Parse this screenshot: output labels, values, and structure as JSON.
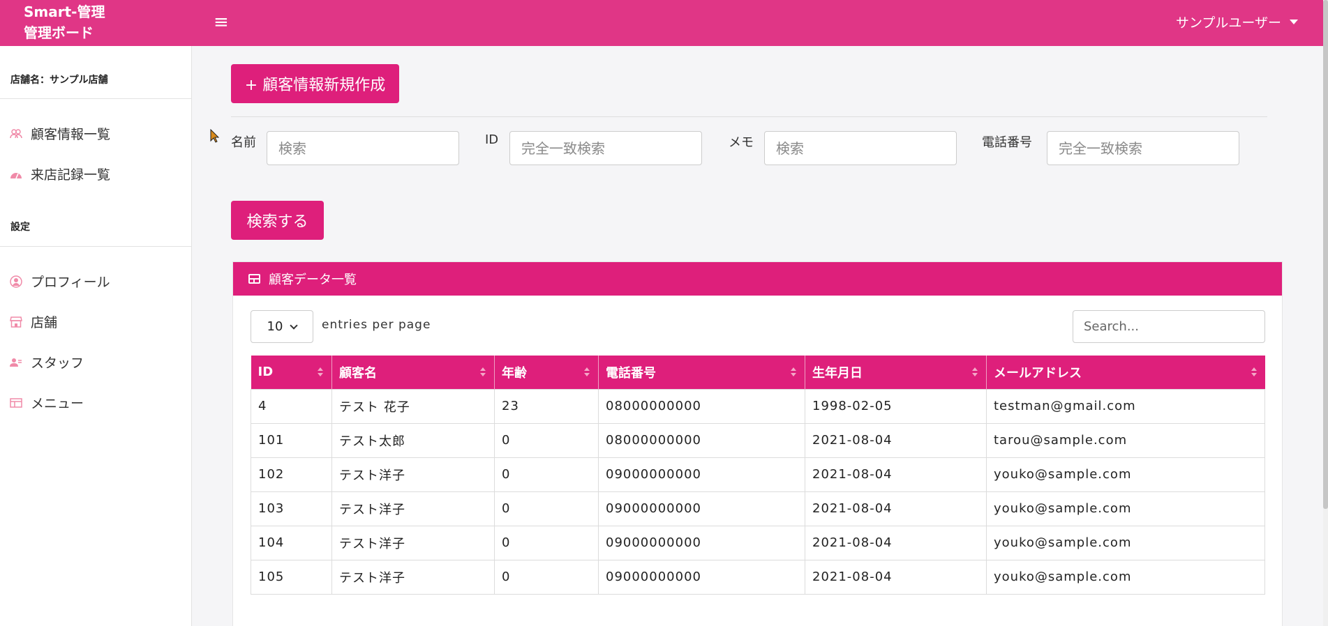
{
  "header": {
    "brand_line1": "Smart-管理",
    "brand_line2": "管理ボード",
    "menu_icon": "hamburger-icon",
    "user_name": "サンプルユーザー"
  },
  "sidebar": {
    "shop_name": "店舗名：サンプル店舗",
    "items": [
      {
        "label": "顧客情報一覧",
        "icon": "users-icon"
      },
      {
        "label": "来店記録一覧",
        "icon": "dashboard-icon"
      }
    ],
    "settings_title": "設定",
    "settings_items": [
      {
        "label": "プロフィール",
        "icon": "user-circle-icon"
      },
      {
        "label": "店舗",
        "icon": "store-icon"
      },
      {
        "label": "スタッフ",
        "icon": "staff-icon"
      },
      {
        "label": "メニュー",
        "icon": "menu-table-icon"
      }
    ]
  },
  "main": {
    "new_button": "+ 顧客情報新規作成",
    "filters": [
      {
        "label": "名前",
        "placeholder": "検索"
      },
      {
        "label": "ID",
        "placeholder": "完全一致検索"
      },
      {
        "label": "メモ",
        "placeholder": "検索"
      },
      {
        "label": "電話番号",
        "placeholder": "完全一致検索"
      }
    ],
    "search_button": "検索する"
  },
  "card": {
    "title": "顧客データ一覧",
    "entries_value": "10",
    "entries_label": "entries per page",
    "search_placeholder": "Search...",
    "columns": [
      "ID",
      "顧客名",
      "年齢",
      "電話番号",
      "生年月日",
      "メールアドレス"
    ],
    "rows": [
      [
        "4",
        "テスト 花子",
        "23",
        "08000000000",
        "1998-02-05",
        "testman@gmail.com"
      ],
      [
        "101",
        "テスト太郎",
        "0",
        "08000000000",
        "2021-08-04",
        "tarou@sample.com"
      ],
      [
        "102",
        "テスト洋子",
        "0",
        "09000000000",
        "2021-08-04",
        "youko@sample.com"
      ],
      [
        "103",
        "テスト洋子",
        "0",
        "09000000000",
        "2021-08-04",
        "youko@sample.com"
      ],
      [
        "104",
        "テスト洋子",
        "0",
        "09000000000",
        "2021-08-04",
        "youko@sample.com"
      ],
      [
        "105",
        "テスト洋子",
        "0",
        "09000000000",
        "2021-08-04",
        "youko@sample.com"
      ]
    ]
  },
  "colors": {
    "brand": "#e03686",
    "accent": "#de1f7b"
  }
}
